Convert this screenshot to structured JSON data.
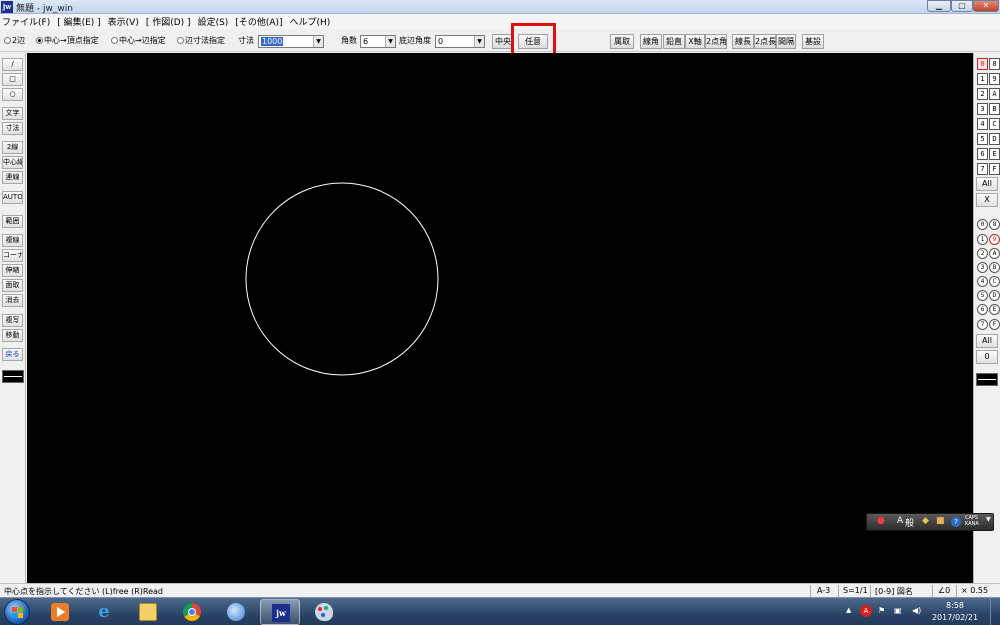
{
  "window": {
    "icon_label": "jw",
    "title": "無題 - jw_win",
    "controls": [
      "minimize",
      "maximize",
      "close"
    ]
  },
  "menu": [
    "ファイル(F)",
    "[ 編集(E) ]",
    "表示(V)",
    "[ 作図(D) ]",
    "設定(S)",
    "[その他(A)]",
    "ヘルプ(H)"
  ],
  "options": {
    "radio1": "2辺",
    "radio2": "中心→頂点指定",
    "radio3": "中心→辺指定",
    "radio4": "辺寸法指定",
    "size_label": "寸法",
    "size_value": "1000",
    "sides_label": "角数",
    "sides_value": "6",
    "base_angle_label": "底辺角度",
    "base_angle_value": "0",
    "center_button": "中央",
    "arbitrary_button": "任意"
  },
  "top_buttons": [
    "属取",
    "線角",
    "鉛直",
    "X軸",
    "2点角",
    "線長",
    "2点長",
    "間隔",
    "基設"
  ],
  "left_tools": [
    "/",
    "□",
    "○",
    "文字",
    "寸法",
    "2線",
    "中心線",
    "連線",
    "AUTO",
    "範囲",
    "複線",
    "コーナー",
    "伸縮",
    "面取",
    "消去",
    "複写",
    "移動",
    "戻る"
  ],
  "layer_groups": [
    [
      "0",
      "8"
    ],
    [
      "1",
      "9"
    ],
    [
      "2",
      "A"
    ],
    [
      "3",
      "B"
    ],
    [
      "4",
      "C"
    ],
    [
      "5",
      "D"
    ],
    [
      "6",
      "E"
    ],
    [
      "7",
      "F"
    ]
  ],
  "layer_all": "All",
  "layer_clear": "X",
  "layers": [
    [
      "0",
      "8"
    ],
    [
      "1",
      "9"
    ],
    [
      "2",
      "A"
    ],
    [
      "3",
      "B"
    ],
    [
      "4",
      "C"
    ],
    [
      "5",
      "D"
    ],
    [
      "6",
      "E"
    ],
    [
      "7",
      "F"
    ]
  ],
  "layer_all2": "All",
  "layer_zero": "0",
  "ime": {
    "mode": "A",
    "input": "般",
    "caps": "CAPS",
    "kana": "KANA"
  },
  "status": {
    "message": "中心点を指示してください (L)free (R)Read",
    "paper": "A-3",
    "scale": "S=1/1",
    "layer": "[0-9] 図名",
    "angle": "∠0",
    "factor": "× 0.55"
  },
  "clock": {
    "time": "8:58",
    "date": "2017/02/21"
  },
  "colors": {
    "canvas": "#000000",
    "circle": "#ffffff",
    "highlight": "#e01010"
  },
  "drawing": {
    "shape": "circle"
  }
}
